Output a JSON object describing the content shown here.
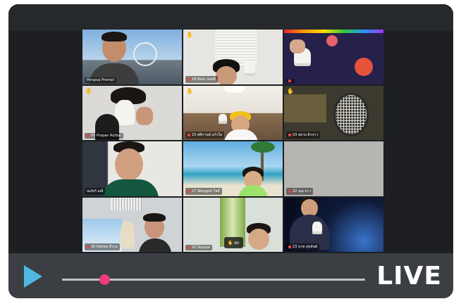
{
  "live_label": "LIVE",
  "colors": {
    "play": "#4fb9e2",
    "scrub_knob": "#ef3b78",
    "frame": "#1d1f22",
    "controls": "#3b3f43"
  },
  "playback_position": 0.14,
  "participants": [
    {
      "name": "Pongsaj Promsil",
      "hand": false
    },
    {
      "name": "18 ศิลปะ ทองดี",
      "hand": true
    },
    {
      "name": "",
      "hand": false
    },
    {
      "name": "05 Prapan Ruthai",
      "hand": true
    },
    {
      "name": "15 ศศิกานต์ แก้วใส",
      "hand": true
    },
    {
      "name": "03 สยาม ผิวขาว",
      "hand": true
    },
    {
      "name": "ณภัทร์ มณี",
      "hand": false
    },
    {
      "name": "27 Wongsiri ใจดี",
      "hand": false
    },
    {
      "name": "22 คุณ ดาว",
      "hand": false
    },
    {
      "name": "30 Ratree ธีรกุล",
      "hand": false
    },
    {
      "name": "20 Sopajai",
      "hand": false
    },
    {
      "name": "23 ปวช สุขสันต์",
      "hand": false
    }
  ],
  "hand_badge": "ยก"
}
